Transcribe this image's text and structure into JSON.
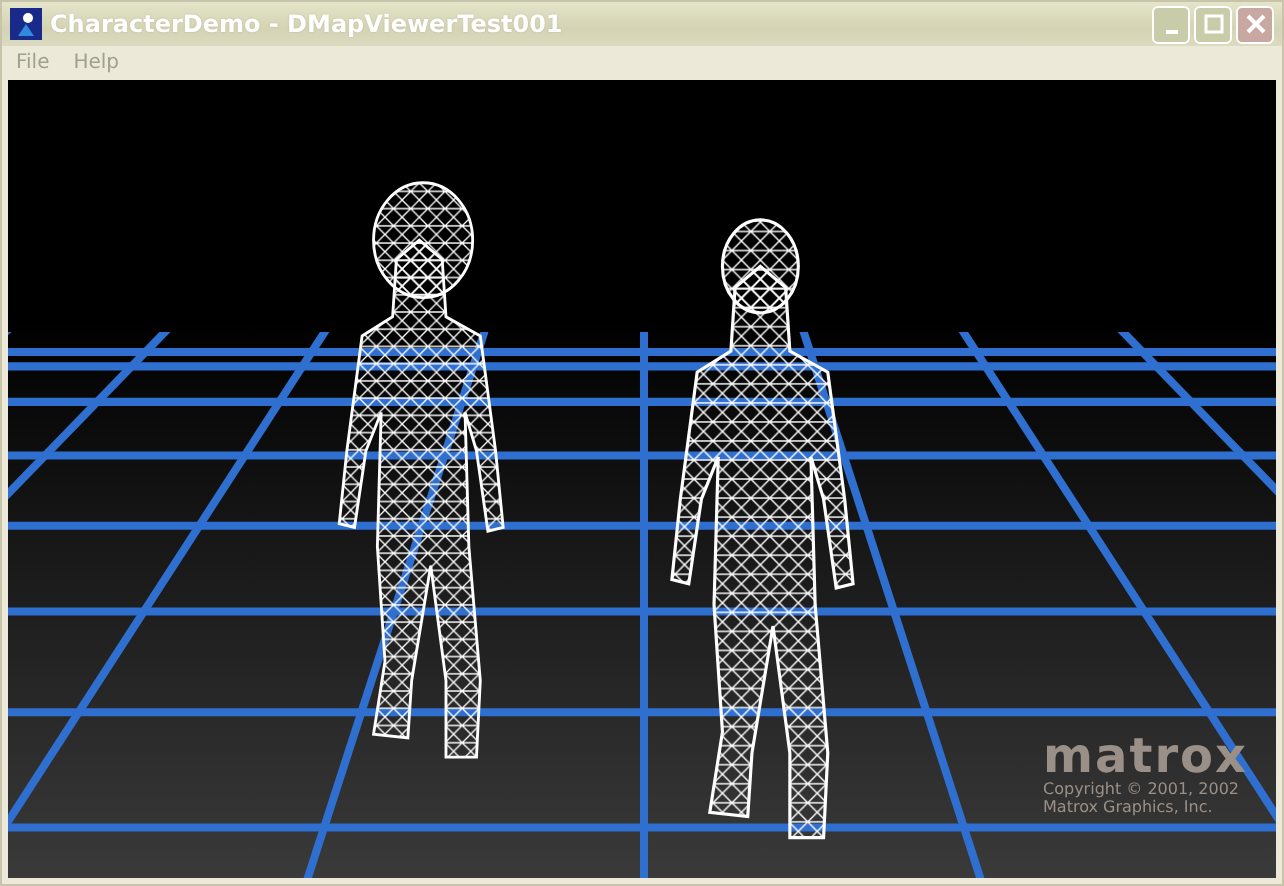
{
  "window": {
    "title": "CharacterDemo - DMapViewerTest001"
  },
  "menu": [
    {
      "label": "File"
    },
    {
      "label": "Help"
    }
  ],
  "logo": {
    "wordmark": "matrox",
    "copyright": [
      "Copyright © 2001, 2002",
      "Matrox Graphics, Inc."
    ]
  }
}
